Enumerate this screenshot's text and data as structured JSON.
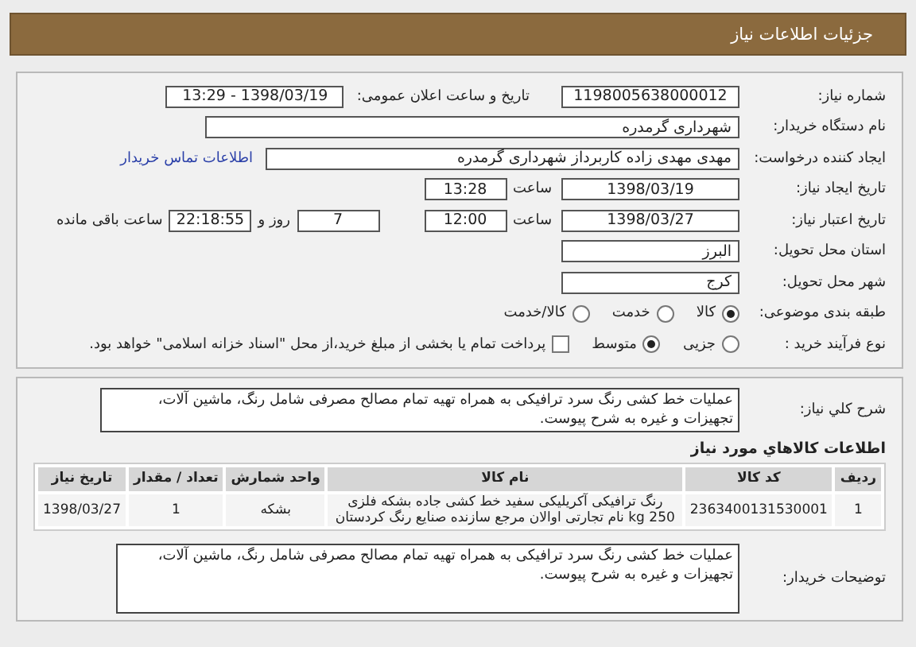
{
  "header": {
    "title": "جزئیات اطلاعات نیاز"
  },
  "need": {
    "number": {
      "label": "شماره نیاز:",
      "value": "1198005638000012"
    },
    "announce": {
      "label": "تاریخ و ساعت اعلان عمومی:",
      "value": "1398/03/19 - 13:29"
    },
    "buyer": {
      "label": "نام دستگاه خریدار:",
      "value": "شهرداری گرمدره"
    },
    "creator": {
      "label": "ایجاد کننده درخواست:",
      "value": "مهدی مهدی زاده کاربرداز شهرداری گرمدره",
      "link": "اطلاعات تماس خریدار"
    },
    "created": {
      "label": "تاریخ ایجاد نیاز:",
      "date": "1398/03/19",
      "time_label": "ساعت",
      "time": "13:28"
    },
    "valid": {
      "label": "تاریخ اعتبار نیاز:",
      "date": "1398/03/27",
      "time_label": "ساعت",
      "time": "12:00",
      "days": "7",
      "days_label": "روز و",
      "remaining": "22:18:55",
      "remaining_label": "ساعت باقی مانده"
    },
    "province": {
      "label": "استان محل تحویل:",
      "value": "البرز"
    },
    "city": {
      "label": "شهر محل تحویل:",
      "value": "کرج"
    },
    "category": {
      "label": "طبقه بندی موضوعی:",
      "options": [
        {
          "label": "کالا",
          "selected": true
        },
        {
          "label": "خدمت",
          "selected": false
        },
        {
          "label": "کالا/خدمت",
          "selected": false
        }
      ]
    },
    "process": {
      "label": "نوع فرآیند خرید :",
      "options": [
        {
          "label": "جزیی",
          "selected": false
        },
        {
          "label": "متوسط",
          "selected": true
        }
      ],
      "payment": {
        "label": "پرداخت تمام یا بخشی از مبلغ خرید،از محل \"اسناد خزانه اسلامی\" خواهد بود.",
        "checked": false
      }
    }
  },
  "summary": {
    "label": "شرح کلي نياز:",
    "value": "عملیات خط کشی رنگ سرد ترافیکی به همراه تهیه تمام مصالح مصرفی شامل رنگ، ماشین آلات، تجهیزات و غیره به شرح پیوست."
  },
  "goods": {
    "title": "اطلاعات کالاهاي مورد نياز",
    "columns": [
      "ردیف",
      "کد کالا",
      "نام کالا",
      "واحد شمارش",
      "تعداد / مقدار",
      "تاریخ نیاز"
    ],
    "rows": [
      [
        "1",
        "2363400131530001",
        "رنگ ترافیکی آکریلیکی سفید خط کشی جاده بشکه فلزی 250 kg نام تجارتی اوالان مرجع سازنده صنایع رنگ کردستان",
        "بشکه",
        "1",
        "1398/03/27"
      ]
    ]
  },
  "notes": {
    "label": "توضیحات خریدار:",
    "value": "عملیات خط کشی رنگ سرد ترافیکی به همراه تهیه تمام مصالح مصرفی شامل رنگ، ماشین آلات، تجهیزات و غیره به شرح پیوست."
  }
}
